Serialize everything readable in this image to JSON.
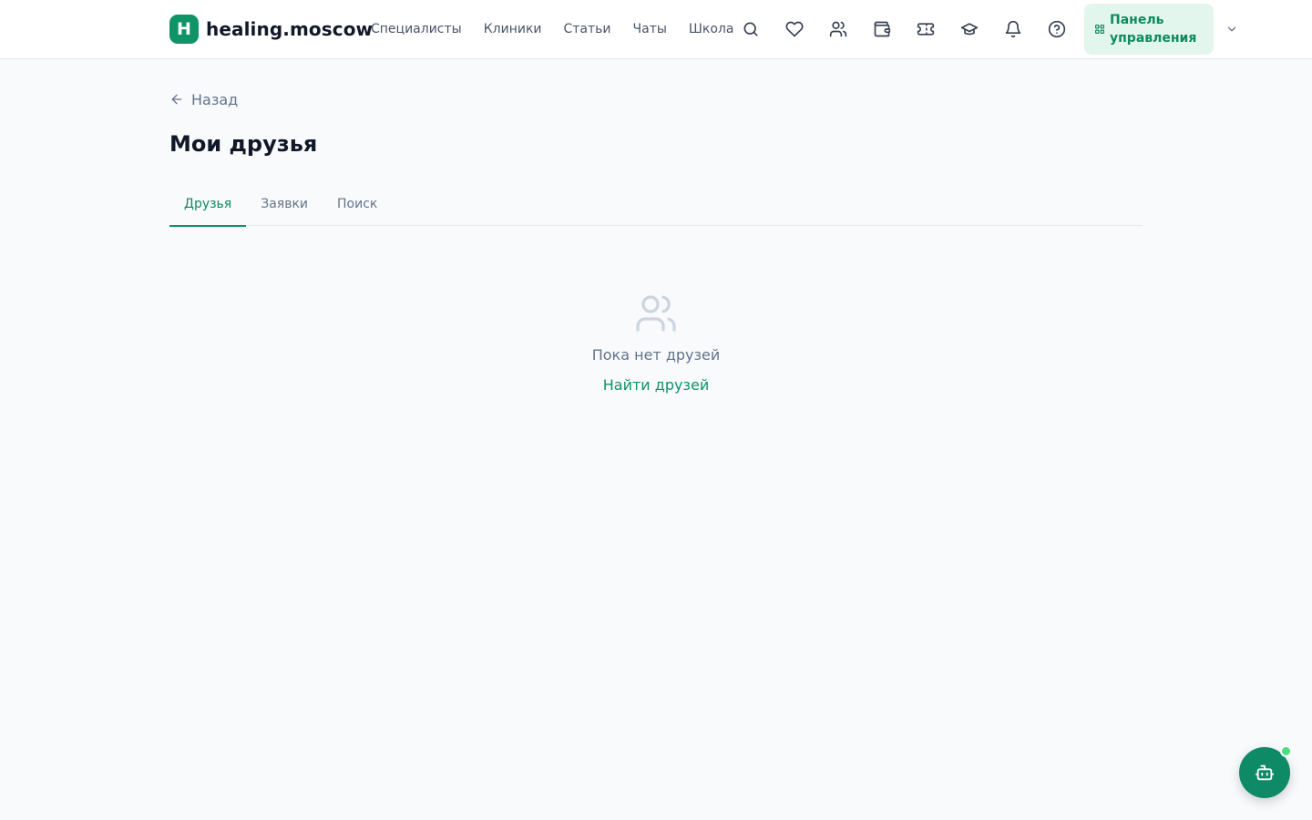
{
  "header": {
    "logo_letter": "H",
    "logo_text": "healing.moscow",
    "nav": [
      {
        "label": "Специалисты"
      },
      {
        "label": "Клиники"
      },
      {
        "label": "Статьи"
      },
      {
        "label": "Чаты"
      },
      {
        "label": "Школа"
      }
    ],
    "icons": [
      "search-icon",
      "heart-icon",
      "users-icon",
      "wallet-icon",
      "ticket-icon",
      "graduation-cap-icon",
      "bell-icon",
      "help-circle-icon"
    ],
    "panel_label": "Панель управления"
  },
  "back_label": "Назад",
  "page_title": "Мои друзья",
  "tabs": [
    {
      "label": "Друзья",
      "active": true
    },
    {
      "label": "Заявки",
      "active": false
    },
    {
      "label": "Поиск",
      "active": false
    }
  ],
  "empty_state": {
    "text": "Пока нет друзей",
    "link": "Найти друзей"
  },
  "colors": {
    "accent": "#0e9467",
    "panel_bg": "#e3f6ee",
    "status_online": "#4ade80",
    "background": "#f8fafc"
  }
}
